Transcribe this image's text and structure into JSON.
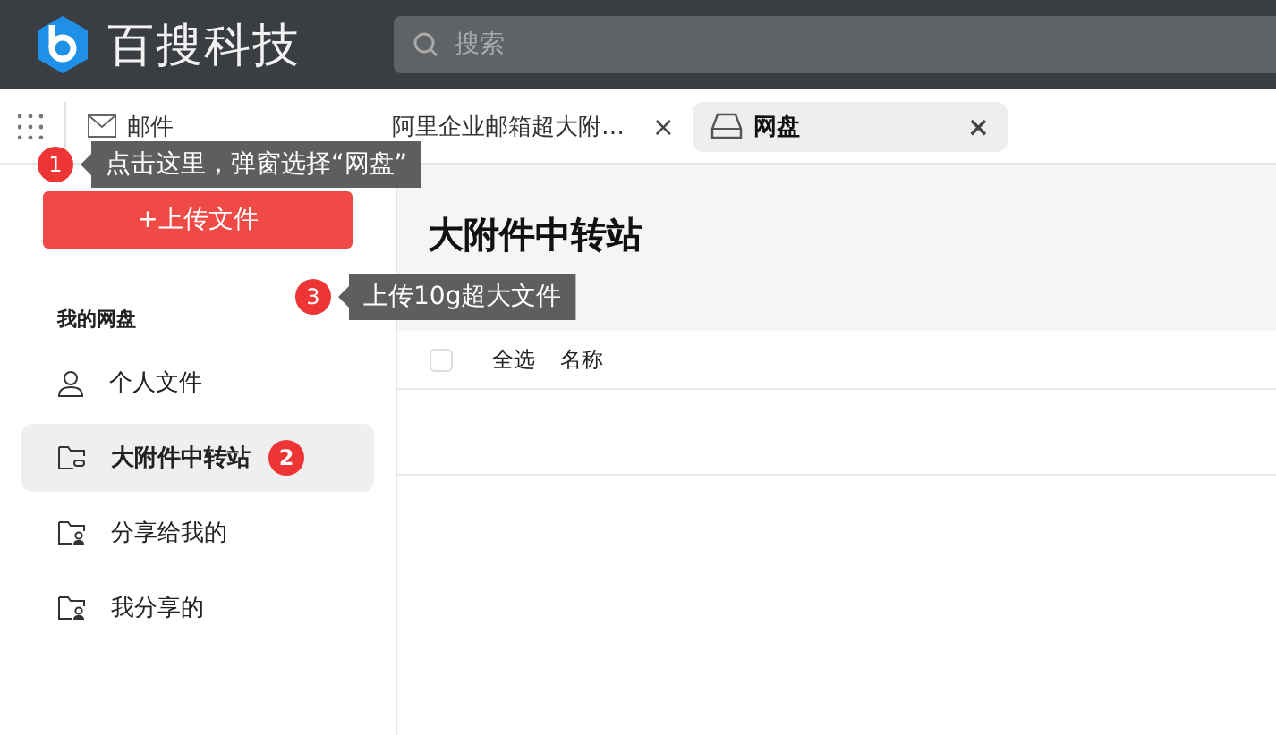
{
  "header": {
    "logo_text": "百搜科技",
    "search": {
      "placeholder": "搜索"
    }
  },
  "tabs": [
    {
      "label": "邮件",
      "selected": false,
      "closable": false
    },
    {
      "label": "阿里企业邮箱超大附…",
      "selected": false,
      "closable": true
    },
    {
      "label": "网盘",
      "selected": true,
      "closable": true
    }
  ],
  "close_glyph": "×",
  "sidebar": {
    "upload_button": "+上传文件",
    "section_title": "我的网盘",
    "items": [
      {
        "label": "个人文件",
        "selected": false
      },
      {
        "label": "大附件中转站",
        "selected": true,
        "badge": "2"
      },
      {
        "label": "分享给我的",
        "selected": false
      },
      {
        "label": "我分享的",
        "selected": false
      }
    ]
  },
  "main": {
    "title": "大附件中转站",
    "columns": [
      {
        "label": "全选",
        "kind": "select-all",
        "checked": false
      },
      {
        "label": "名称",
        "kind": "text"
      }
    ]
  },
  "callouts": [
    {
      "badge": "1",
      "text": "点击这里，弹窗选择“网盘”"
    },
    {
      "badge": "3",
      "text": "上传10g超大文件"
    }
  ]
}
